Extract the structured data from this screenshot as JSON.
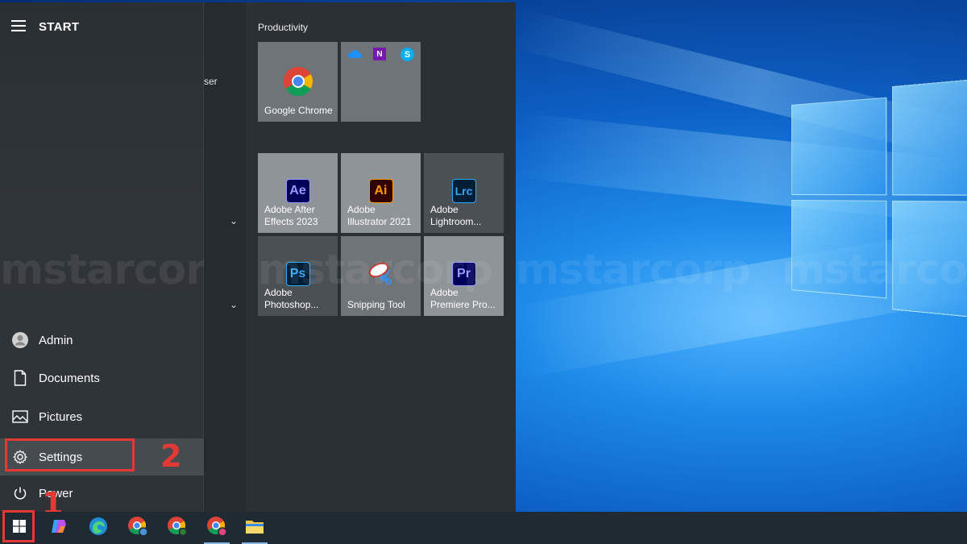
{
  "start_menu": {
    "title": "START",
    "nav": {
      "admin": "Admin",
      "documents": "Documents",
      "pictures": "Pictures",
      "settings": "Settings",
      "power": "Power"
    },
    "app_list_fragment": "ser",
    "groups": [
      {
        "title": "Productivity"
      }
    ],
    "tiles": {
      "chrome": "Google Chrome",
      "after_effects": "Adobe After Effects 2023",
      "illustrator": "Adobe Illustrator 2021",
      "lightroom": "Adobe Lightroom...",
      "photoshop": "Adobe Photoshop...",
      "snipping": "Snipping Tool",
      "premiere": "Adobe Premiere Pro..."
    },
    "tile_icon_text": {
      "ae": "Ae",
      "ai": "Ai",
      "lrc": "Lrc",
      "ps": "Ps",
      "pr": "Pr"
    }
  },
  "annotations": {
    "step_1": "1",
    "step_2": "2",
    "highlight_color": "#e53935"
  },
  "watermark": "mstarcorp",
  "taskbar": {
    "icons": [
      "windows-start-icon",
      "copilot-icon",
      "edge-icon",
      "chrome-profile-icon",
      "chrome-icon",
      "chrome-n-icon",
      "file-explorer-icon"
    ]
  },
  "colors": {
    "desktop_blue": "#0d5fc4",
    "start_bg": "#2b3034",
    "taskbar_bg": "#1f2a33",
    "ae_bg": "#00005b",
    "ai_bg": "#330000",
    "lrc_bg": "#001e36",
    "ps_bg": "#001e36",
    "pr_bg": "#00005b"
  }
}
